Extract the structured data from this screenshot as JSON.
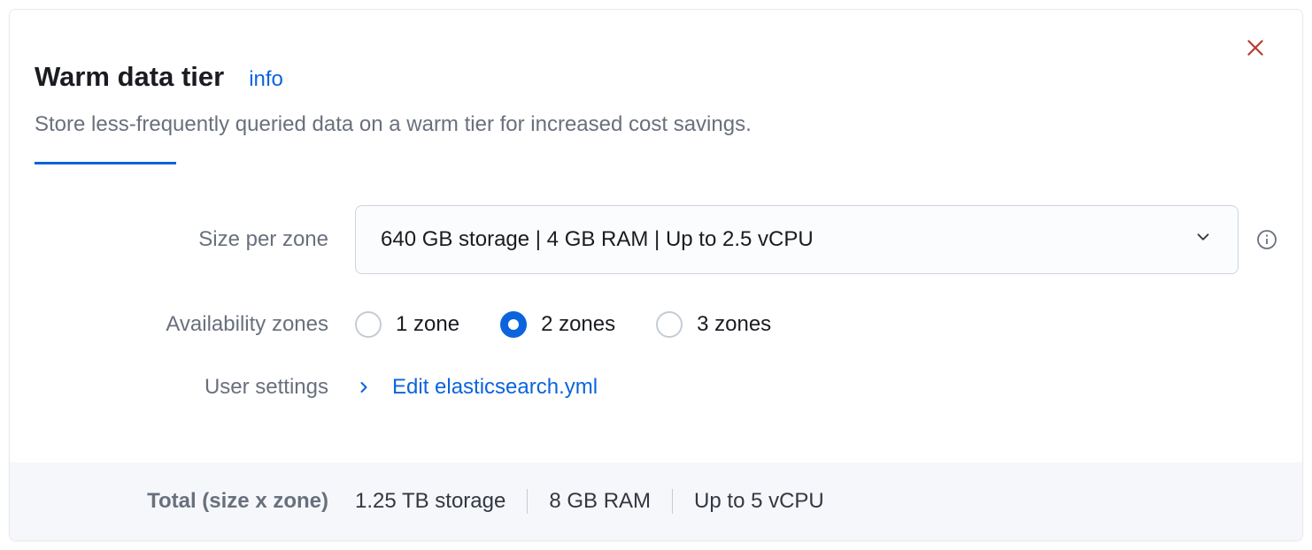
{
  "header": {
    "title": "Warm data tier",
    "info_label": "info",
    "subtitle": "Store less-frequently queried data on a warm tier for increased cost savings."
  },
  "form": {
    "size_per_zone": {
      "label": "Size per zone",
      "selected": "640 GB storage | 4 GB RAM | Up to 2.5 vCPU"
    },
    "availability_zones": {
      "label": "Availability zones",
      "options": [
        {
          "label": "1 zone",
          "selected": false
        },
        {
          "label": "2 zones",
          "selected": true
        },
        {
          "label": "3 zones",
          "selected": false
        }
      ]
    },
    "user_settings": {
      "label": "User settings",
      "action": "Edit elasticsearch.yml"
    }
  },
  "footer": {
    "label": "Total (size x zone)",
    "storage": "1.25 TB storage",
    "ram": "8 GB RAM",
    "cpu": "Up to 5 vCPU"
  }
}
